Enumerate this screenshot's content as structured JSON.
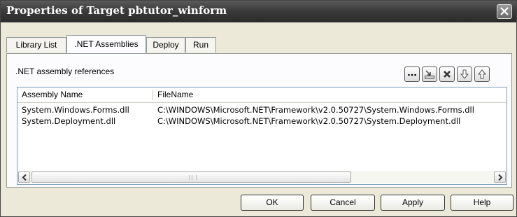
{
  "window": {
    "title": "Properties of Target pbtutor_winform",
    "close_icon": "close-icon"
  },
  "tabs": [
    {
      "label": "Library List",
      "active": false
    },
    {
      "label": ".NET Assemblies",
      "active": true
    },
    {
      "label": "Deploy",
      "active": false
    },
    {
      "label": "Run",
      "active": false
    }
  ],
  "panel": {
    "section_label": ".NET assembly references",
    "toolbar": [
      {
        "icon": "ellipsis-icon",
        "label": "..."
      },
      {
        "icon": "import-icon"
      },
      {
        "icon": "delete-icon"
      },
      {
        "icon": "move-down-icon"
      },
      {
        "icon": "move-up-icon"
      }
    ],
    "list": {
      "columns": [
        "Assembly Name",
        "FileName"
      ],
      "rows": [
        {
          "name": "System.Windows.Forms.dll",
          "file": "C:\\WINDOWS\\Microsoft.NET\\Framework\\v2.0.50727\\System.Windows.Forms.dll"
        },
        {
          "name": "System.Deployment.dll",
          "file": "C:\\WINDOWS\\Microsoft.NET\\Framework\\v2.0.50727\\System.Deployment.dll"
        }
      ]
    }
  },
  "buttons": {
    "ok": "OK",
    "cancel": "Cancel",
    "apply": "Apply",
    "help": "Help"
  },
  "colors": {
    "titlebar": "#3c3c3c",
    "dialog_face": "#ece9d8",
    "tab_border": "#919b9c"
  }
}
